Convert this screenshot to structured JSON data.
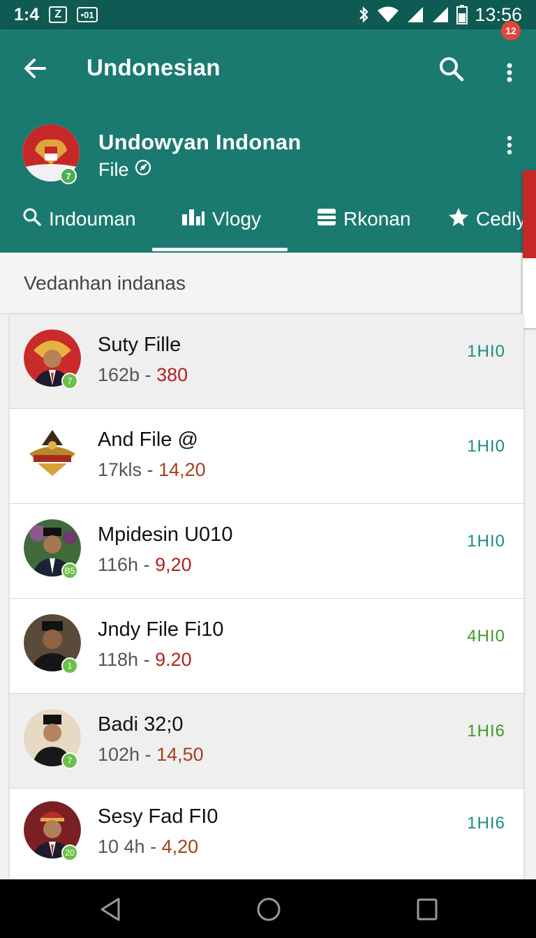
{
  "status_bar": {
    "time_left": "1:4",
    "icon_box1": "Z",
    "icon_box2": "•01",
    "clock": "13:56",
    "icons": [
      "bluetooth-icon",
      "wifi-icon",
      "signal-icon",
      "signal-icon",
      "battery-icon"
    ]
  },
  "app_bar": {
    "title": "Undonesian",
    "notification_badge": "12"
  },
  "profile": {
    "name": "Undowyan Indonan",
    "subtitle": "File",
    "avatar_badge": "7"
  },
  "tabs": [
    {
      "label": "Indouman",
      "icon": "search-icon"
    },
    {
      "label": "Vlogy",
      "icon": "chart-icon",
      "active": true
    },
    {
      "label": "Rkonan",
      "icon": "list-icon"
    },
    {
      "label": "Cedly",
      "icon": "star-icon"
    }
  ],
  "section": {
    "header": "Vedanhan indanas"
  },
  "items": [
    {
      "name": "Suty Fille",
      "size": "162b",
      "sep": "-",
      "value": "380",
      "time": "1HI0",
      "badge": "7"
    },
    {
      "name": "And File @",
      "size": "17kls",
      "sep": "-",
      "value": "14,20",
      "time": "1HI0",
      "badge": ""
    },
    {
      "name": "Mpidesin U010",
      "size": "116h",
      "sep": "-",
      "value": "9,20",
      "time": "1HI0",
      "badge": "B5"
    },
    {
      "name": "Jndy File Fi10",
      "size": "118h",
      "sep": "-",
      "value": "9.20",
      "time": "4HI0",
      "badge": "1"
    },
    {
      "name": "Badi 32;0",
      "size": "102h",
      "sep": "-",
      "value": "14,50",
      "time": "1HI6",
      "badge": "7"
    },
    {
      "name": "Sesy Fad FI0",
      "size": "10 4h",
      "sep": "-",
      "value": "4,20",
      "time": "1HI6",
      "badge": "20"
    }
  ],
  "colors": {
    "app_bar": "#1a7a70",
    "status_bar": "#0f5a52",
    "accent_time": "#1e8b80",
    "value_red": "#b32121"
  }
}
